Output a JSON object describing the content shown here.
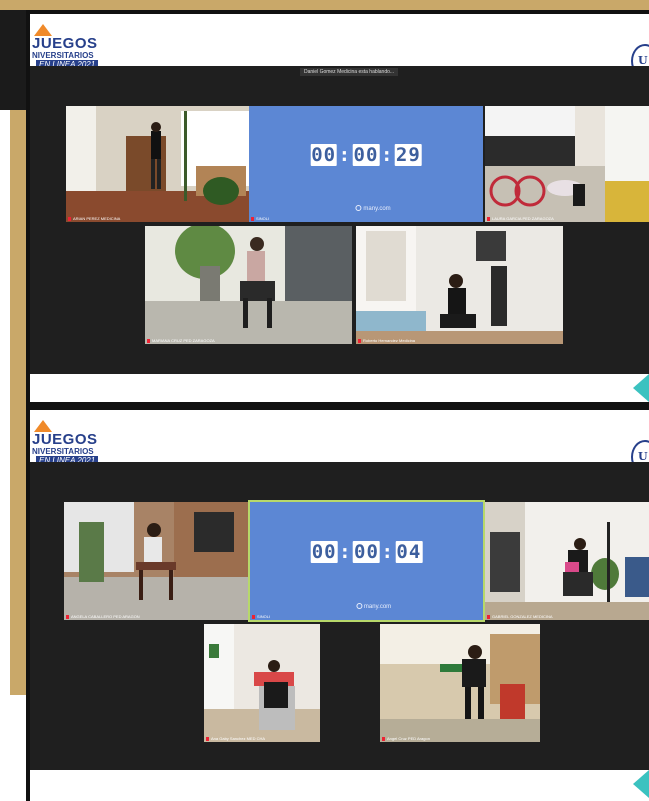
{
  "event_title": {
    "line1": "JUEGOS",
    "line2": "NIVERSITARIOS",
    "line3": "EN LINEA 2021"
  },
  "badge_letter": "U",
  "top_caption": "Daniel Gomez Medicina esta hablando...",
  "timer_brand": "many.com",
  "screens": [
    {
      "timer": [
        "00",
        "00",
        "29"
      ],
      "timer_label": "SINOLI",
      "participants": [
        "ARIAN PEREZ MEDICINA",
        "LAURA GARCIA PED ZARAGOZA",
        "MARIANA CRUZ PED ZARAGOZA",
        "Roberto Hernandez Medicina"
      ]
    },
    {
      "timer": [
        "00",
        "00",
        "04"
      ],
      "timer_label": "SINOLI",
      "participants": [
        "ANGELA CABALLERO PED ARAGON",
        "GABRIEL GONZALEZ MEDICINA",
        "Ana Gaby Sanchez MED CHA",
        "Angel Cruz PED Aragon"
      ]
    }
  ],
  "colors": {
    "frame_gold": "#c9a869",
    "grid_bg": "#1f1f1f",
    "timer_bg": "#5c87d4",
    "logo_blue": "#27408b",
    "accent_orange": "#f08a2a",
    "accent_teal": "#3bc2c0",
    "active_speaker": "#b7d86a"
  }
}
